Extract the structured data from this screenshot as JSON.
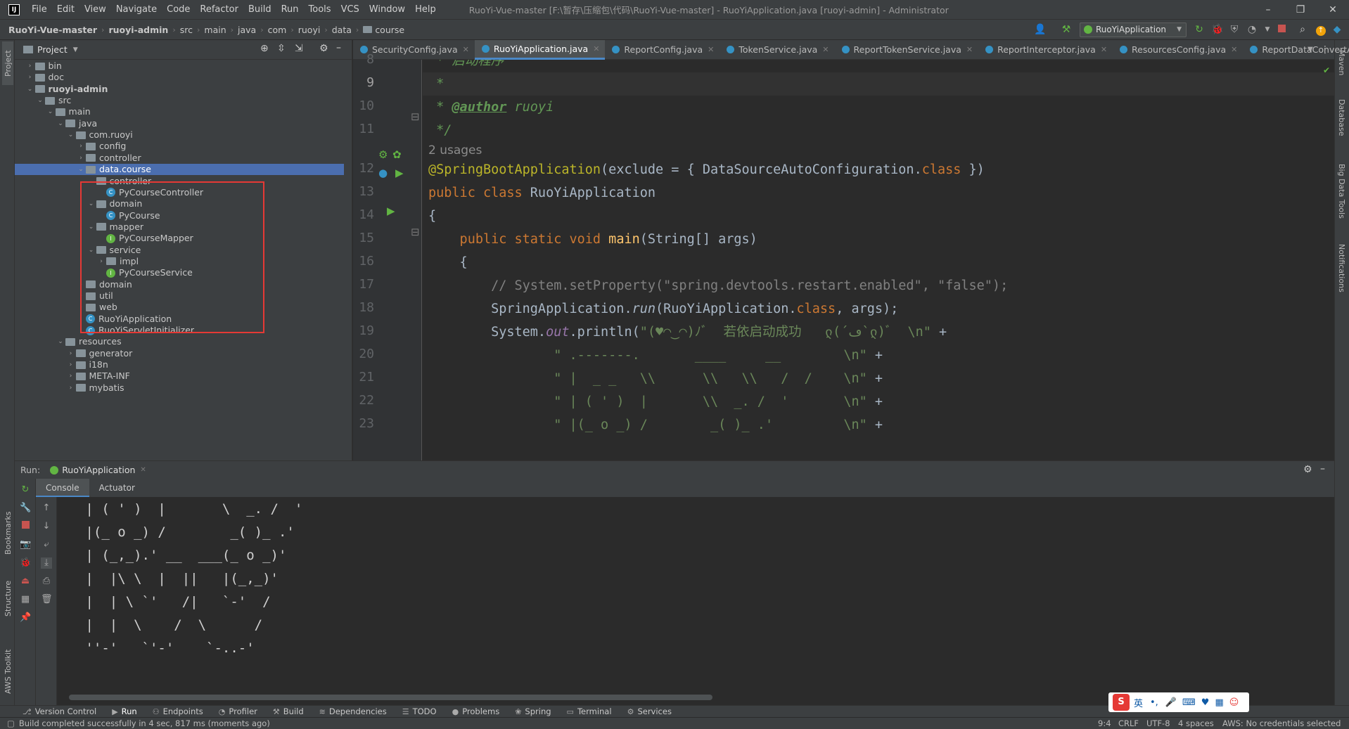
{
  "titlebar": {
    "menus": [
      "File",
      "Edit",
      "View",
      "Navigate",
      "Code",
      "Refactor",
      "Build",
      "Run",
      "Tools",
      "VCS",
      "Window",
      "Help"
    ],
    "title": "RuoYi-Vue-master [F:\\暂存\\压缩包\\代码\\RuoYi-Vue-master] - RuoYiApplication.java [ruoyi-admin] - Administrator"
  },
  "breadcrumb": [
    "RuoYi-Vue-master",
    "ruoyi-admin",
    "src",
    "main",
    "java",
    "com",
    "ruoyi",
    "data",
    "course"
  ],
  "run_config": "RuoYiApplication",
  "project_panel": {
    "title": "Project",
    "tree": [
      {
        "label": "bin",
        "type": "folder",
        "depth": 1,
        "arrow": "right"
      },
      {
        "label": "doc",
        "type": "folder",
        "depth": 1,
        "arrow": "right"
      },
      {
        "label": "ruoyi-admin",
        "type": "folder",
        "depth": 1,
        "arrow": "down",
        "bold": true
      },
      {
        "label": "src",
        "type": "folder",
        "depth": 2,
        "arrow": "down"
      },
      {
        "label": "main",
        "type": "folder",
        "depth": 3,
        "arrow": "down"
      },
      {
        "label": "java",
        "type": "folder",
        "depth": 4,
        "arrow": "down"
      },
      {
        "label": "com.ruoyi",
        "type": "folder",
        "depth": 5,
        "arrow": "down"
      },
      {
        "label": "config",
        "type": "folder",
        "depth": 6,
        "arrow": "right"
      },
      {
        "label": "controller",
        "type": "folder",
        "depth": 6,
        "arrow": "right"
      },
      {
        "label": "data.course",
        "type": "folder",
        "depth": 6,
        "arrow": "down",
        "selected": true
      },
      {
        "label": "controller",
        "type": "folder",
        "depth": 7,
        "arrow": "down"
      },
      {
        "label": "PyCourseController",
        "type": "class",
        "depth": 8,
        "arrow": ""
      },
      {
        "label": "domain",
        "type": "folder",
        "depth": 7,
        "arrow": "down"
      },
      {
        "label": "PyCourse",
        "type": "class",
        "depth": 8,
        "arrow": ""
      },
      {
        "label": "mapper",
        "type": "folder",
        "depth": 7,
        "arrow": "down"
      },
      {
        "label": "PyCourseMapper",
        "type": "interface",
        "depth": 8,
        "arrow": ""
      },
      {
        "label": "service",
        "type": "folder",
        "depth": 7,
        "arrow": "down"
      },
      {
        "label": "impl",
        "type": "folder",
        "depth": 8,
        "arrow": "right"
      },
      {
        "label": "PyCourseService",
        "type": "interface",
        "depth": 8,
        "arrow": ""
      },
      {
        "label": "domain",
        "type": "folder",
        "depth": 6,
        "arrow": "right"
      },
      {
        "label": "util",
        "type": "folder",
        "depth": 6,
        "arrow": "right"
      },
      {
        "label": "web",
        "type": "folder",
        "depth": 6,
        "arrow": "right"
      },
      {
        "label": "RuoYiApplication",
        "type": "class",
        "depth": 6,
        "arrow": ""
      },
      {
        "label": "RuoYiServletInitializer",
        "type": "class",
        "depth": 6,
        "arrow": ""
      },
      {
        "label": "resources",
        "type": "folder",
        "depth": 4,
        "arrow": "down"
      },
      {
        "label": "generator",
        "type": "folder",
        "depth": 5,
        "arrow": "right"
      },
      {
        "label": "i18n",
        "type": "folder",
        "depth": 5,
        "arrow": "right"
      },
      {
        "label": "META-INF",
        "type": "folder",
        "depth": 5,
        "arrow": "right"
      },
      {
        "label": "mybatis",
        "type": "folder",
        "depth": 5,
        "arrow": "right"
      }
    ]
  },
  "editor": {
    "tabs": [
      {
        "label": "SecurityConfig.java",
        "active": false
      },
      {
        "label": "RuoYiApplication.java",
        "active": true
      },
      {
        "label": "ReportConfig.java",
        "active": false
      },
      {
        "label": "TokenService.java",
        "active": false
      },
      {
        "label": "ReportTokenService.java",
        "active": false
      },
      {
        "label": "ReportInterceptor.java",
        "active": false
      },
      {
        "label": "ResourcesConfig.java",
        "active": false
      },
      {
        "label": "ReportDataConvertAc",
        "active": false
      }
    ],
    "line_numbers": [
      "8",
      "9",
      "10",
      "11",
      "",
      "12",
      "13",
      "14",
      "15",
      "16",
      "17",
      "18",
      "19",
      "20",
      "21",
      "22",
      "23"
    ],
    "usages": "2 usages",
    "code": {
      "l8": " * 启动程序",
      "l9": " *",
      "l10_tag": "@author",
      "l10_rest": " ruoyi",
      "l11": " */",
      "l12_ann": "@SpringBootApplication",
      "l12_a": "(exclude = { DataSourceAutoConfiguration.",
      "l12_kw": "class",
      "l12_b": " })",
      "l13_kw": "public class",
      "l13_rest": " RuoYiApplication",
      "l14": "{",
      "l15_kw": "    public static void",
      "l15_fn": " main",
      "l15_rest": "(String[] args)",
      "l16": "    {",
      "l17": "        // System.setProperty(\"spring.devtools.restart.enabled\", \"false\");",
      "l18_a": "        SpringApplication.",
      "l18_run": "run",
      "l18_b": "(RuoYiApplication.",
      "l18_kw": "class",
      "l18_c": ", args);",
      "l19_a": "        System.",
      "l19_out": "out",
      "l19_b": ".println(",
      "l19_str": "\"(♥◠‿◠)ﾉﾞ  若依启动成功   ლ(´ڡ`ლ)ﾞ  \\n\"",
      "l19_c": " +",
      "l20_str": "\" .-------.       ____     __        \\n\"",
      "l21_str": "\" |  _ _   \\\\      \\\\   \\\\   /  /    \\n\"",
      "l22_str": "\" | ( ' )  |       \\\\  _. /  '       \\n\"",
      "l23_str": "\" |(_ o _) /        _( )_ .'         \\n\"",
      "plus": " +"
    }
  },
  "run_panel": {
    "label": "Run:",
    "config_tab": "RuoYiApplication",
    "subtabs": [
      "Console",
      "Actuator"
    ],
    "console_lines": [
      " | ( ' )  |       \\  _. /  '",
      " |(_ o _) /        _( )_ .'",
      " | (_,_).' __  ___(_ o _)'",
      " |  |\\ \\  |  ||   |(_,_)'",
      " |  | \\ `'   /|   `-'  /",
      " |  |  \\    /  \\      /",
      " ''-'   `'-'    `-..-'"
    ]
  },
  "bottom_tools": [
    "Version Control",
    "Run",
    "Endpoints",
    "Profiler",
    "Build",
    "Dependencies",
    "TODO",
    "Problems",
    "Spring",
    "Terminal",
    "Services"
  ],
  "status": {
    "message": "Build completed successfully in 4 sec, 817 ms (moments ago)",
    "position": "9:4",
    "line_sep": "CRLF",
    "encoding": "UTF-8",
    "indent": "4 spaces",
    "aws": "AWS: No credentials selected"
  },
  "left_stripe": [
    "Project",
    "Bookmarks",
    "Structure",
    "AWS Toolkit"
  ],
  "right_stripe": [
    "Maven",
    "Database",
    "Big Data Tools",
    "Notifications"
  ],
  "ime": "英"
}
